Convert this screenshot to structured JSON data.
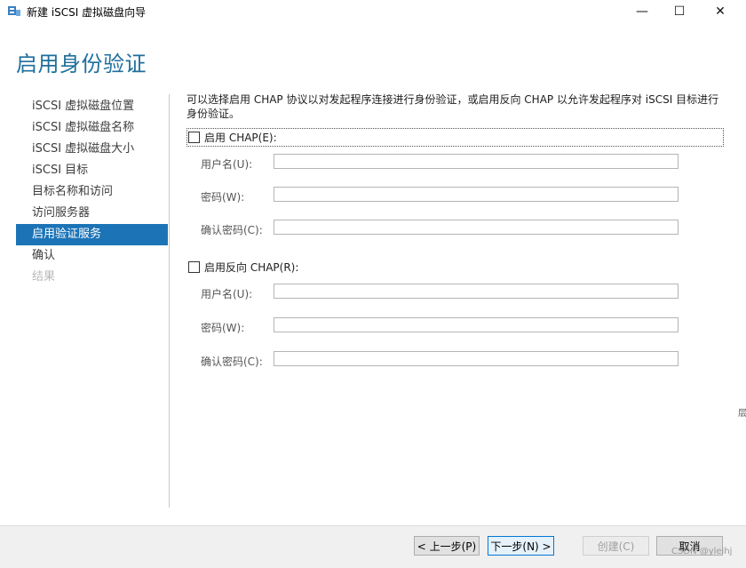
{
  "window": {
    "title": "新建 iSCSI 虚拟磁盘向导",
    "minimize_glyph": "—",
    "maximize_glyph": "☐",
    "close_glyph": "✕"
  },
  "page": {
    "title": "启用身份验证"
  },
  "nav": {
    "items": [
      {
        "label": "iSCSI 虚拟磁盘位置",
        "state": "normal"
      },
      {
        "label": "iSCSI 虚拟磁盘名称",
        "state": "normal"
      },
      {
        "label": "iSCSI 虚拟磁盘大小",
        "state": "normal"
      },
      {
        "label": "iSCSI 目标",
        "state": "normal"
      },
      {
        "label": "目标名称和访问",
        "state": "normal"
      },
      {
        "label": "访问服务器",
        "state": "normal"
      },
      {
        "label": "启用验证服务",
        "state": "active"
      },
      {
        "label": "确认",
        "state": "normal"
      },
      {
        "label": "结果",
        "state": "disabled"
      }
    ]
  },
  "content": {
    "description": "可以选择启用 CHAP 协议以对发起程序连接进行身份验证，或启用反向 CHAP 以允许发起程序对 iSCSI 目标进行身份验证。",
    "chap": {
      "checkbox_label": "启用 CHAP(E):",
      "checked": false,
      "username_label": "用户名(U):",
      "password_label": "密码(W):",
      "confirm_label": "确认密码(C):",
      "username_value": "",
      "password_value": "",
      "confirm_value": ""
    },
    "reverse_chap": {
      "checkbox_label": "启用反向 CHAP(R):",
      "checked": false,
      "username_label": "用户名(U):",
      "password_label": "密码(W):",
      "confirm_label": "确认密码(C):",
      "username_value": "",
      "password_value": "",
      "confirm_value": ""
    }
  },
  "footer": {
    "prev_label": "< 上一步(P)",
    "next_label": "下一步(N) >",
    "create_label": "创建(C)",
    "cancel_label": "取消",
    "watermark": "CSDN @yleihj"
  },
  "edge": {
    "text": "层"
  },
  "colors": {
    "accent": "#1c74b7",
    "title": "#1f6e9c",
    "footer_bg": "#f0f0f0"
  }
}
